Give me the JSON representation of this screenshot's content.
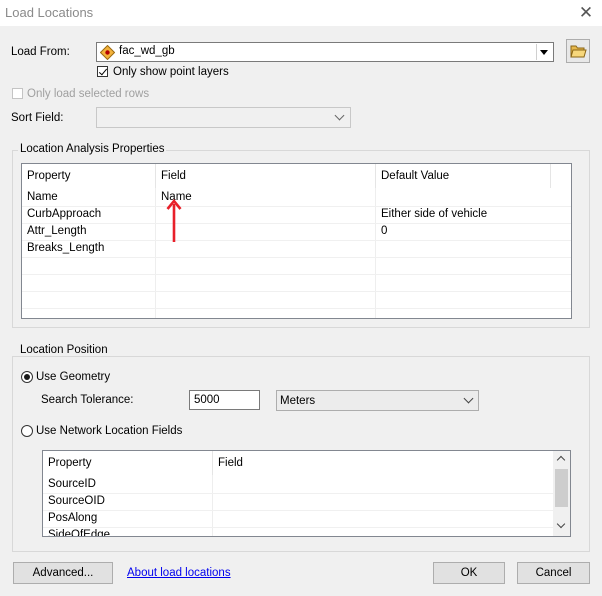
{
  "window": {
    "title": "Load Locations",
    "close_glyph": "✕"
  },
  "load_from": {
    "label": "Load From:",
    "value": "fac_wd_gb",
    "only_point_layers_label": "Only show point layers",
    "only_point_layers_checked": true
  },
  "only_selected_rows": {
    "label": "Only load selected rows",
    "checked": false
  },
  "sort_field": {
    "label": "Sort Field:",
    "value": ""
  },
  "analysis_props": {
    "title": "Location Analysis Properties",
    "columns": [
      "Property",
      "Field",
      "Default Value"
    ],
    "rows": [
      {
        "property": "Name",
        "field": "Name",
        "default": ""
      },
      {
        "property": "CurbApproach",
        "field": "",
        "default": "Either side of vehicle"
      },
      {
        "property": "Attr_Length",
        "field": "",
        "default": "0"
      },
      {
        "property": "Breaks_Length",
        "field": "",
        "default": ""
      }
    ]
  },
  "location_position": {
    "title": "Location Position",
    "use_geometry_label": "Use Geometry",
    "use_geometry_selected": true,
    "search_tolerance_label": "Search Tolerance:",
    "search_tolerance_value": "5000",
    "units_value": "Meters",
    "use_network_fields_label": "Use Network Location Fields",
    "network_columns": [
      "Property",
      "Field"
    ],
    "network_rows": [
      {
        "property": "SourceID",
        "field": ""
      },
      {
        "property": "SourceOID",
        "field": ""
      },
      {
        "property": "PosAlong",
        "field": ""
      },
      {
        "property": "SideOfEdge",
        "field": ""
      }
    ]
  },
  "footer": {
    "advanced_label": "Advanced...",
    "about_link": "About load locations",
    "ok_label": "OK",
    "cancel_label": "Cancel"
  },
  "colors": {
    "annotation_arrow": "#e8202a",
    "link": "#0000ee"
  }
}
